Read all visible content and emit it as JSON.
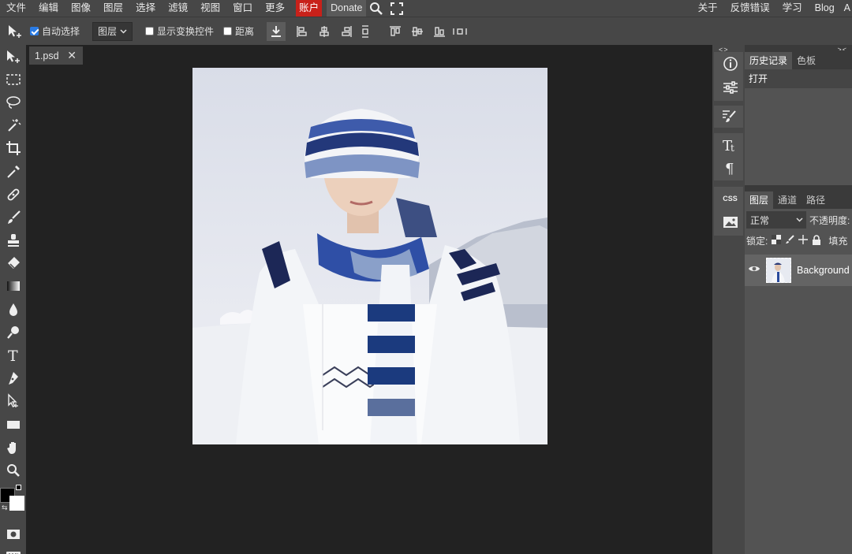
{
  "menubar": {
    "items": [
      "文件",
      "编辑",
      "图像",
      "图层",
      "选择",
      "滤镜",
      "视图",
      "窗口",
      "更多"
    ],
    "account": "账户",
    "donate": "Donate",
    "right_items": [
      "关于",
      "反馈错误",
      "学习",
      "Blog",
      "A"
    ]
  },
  "options": {
    "auto_select_label": "自动选择",
    "auto_select_checked": true,
    "target_select": "图层",
    "show_transform_label": "显示变换控件",
    "show_transform_checked": false,
    "distance_label": "距离",
    "distance_checked": false
  },
  "document": {
    "tab_title": "1.psd",
    "close_glyph": "✕"
  },
  "side_column": {
    "collapse_glyph": "<>",
    "css_label": "CSS"
  },
  "history_panel": {
    "tabs": [
      "历史记录",
      "色板"
    ],
    "active_tab": 0,
    "collapse_glyph": "><",
    "entries": [
      "打开"
    ]
  },
  "layers_panel": {
    "tabs": [
      "图层",
      "通道",
      "路径"
    ],
    "active_tab": 0,
    "blend_mode": "正常",
    "opacity_label": "不透明度:",
    "lock_label": "锁定:",
    "fill_label": "填充",
    "layers": [
      {
        "name": "Background",
        "visible": true
      }
    ]
  },
  "colors": {
    "foreground": "#000000",
    "background": "#ffffff",
    "account_red": "#c8211a",
    "panel": "#474747",
    "workspace": "#222222"
  },
  "icons": {
    "menubar": [
      "search-icon",
      "fullscreen-icon"
    ],
    "tools": [
      "move-tool-icon",
      "marquee-tool-icon",
      "lasso-tool-icon",
      "magic-wand-icon",
      "crop-icon",
      "eyedropper-icon",
      "healing-icon",
      "brush-icon",
      "clone-stamp-icon",
      "eraser-icon",
      "gradient-icon",
      "blur-icon",
      "dodge-icon",
      "type-icon",
      "pen-icon",
      "path-select-icon",
      "rectangle-icon",
      "hand-icon",
      "zoom-icon",
      "quick-mask-icon",
      "keyboard-icon"
    ],
    "side": [
      "info-icon",
      "adjustments-icon",
      "brush-settings-icon",
      "character-icon",
      "paragraph-icon",
      "css-icon",
      "image-icon"
    ]
  }
}
